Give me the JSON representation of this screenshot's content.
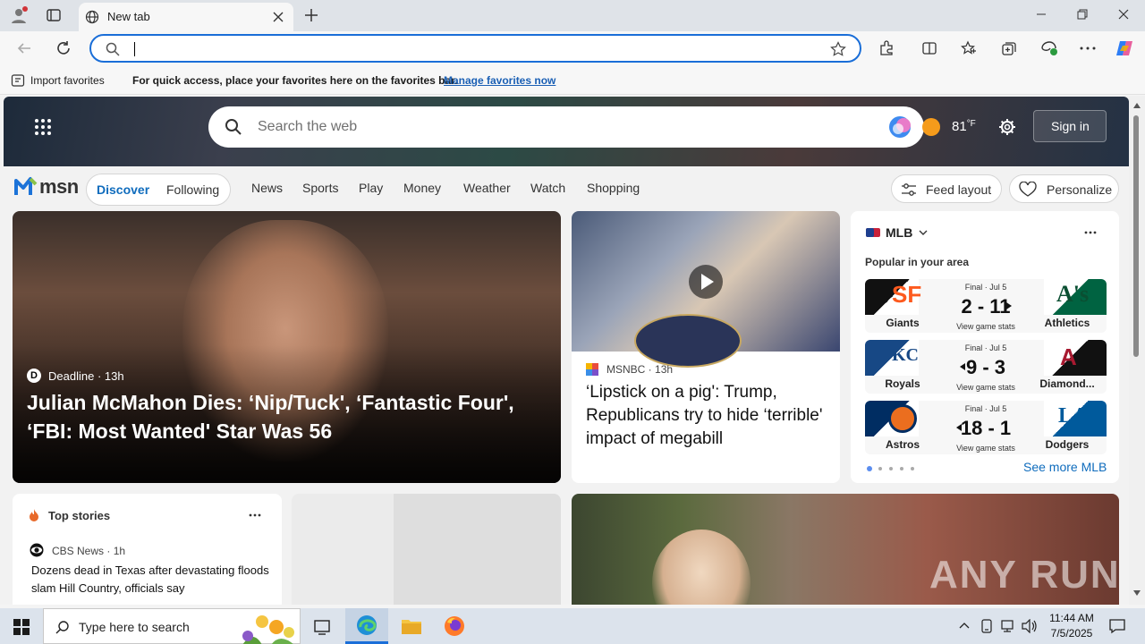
{
  "browser": {
    "tab_title": "New tab",
    "address_value": "",
    "favbar": {
      "import_label": "Import favorites",
      "message": "For quick access, place your favorites here on the favorites bar.",
      "manage_link": "Manage favorites now"
    }
  },
  "msn": {
    "search_placeholder": "Search the web",
    "weather_temp": "81",
    "weather_unit": "°F",
    "sign_in": "Sign in",
    "logo_text": "msn",
    "tabs": [
      "Discover",
      "Following"
    ],
    "nav": [
      "News",
      "Sports",
      "Play",
      "Money",
      "Weather",
      "Watch",
      "Shopping"
    ],
    "feed_layout": "Feed layout",
    "personalize": "Personalize",
    "hero_article": {
      "source": "Deadline",
      "age": "13h",
      "headline": "Julian McMahon Dies: ‘Nip/Tuck', ‘Fantastic Four', ‘FBI: Most Wanted' Star Was 56"
    },
    "video_article": {
      "source": "MSNBC",
      "age": "13h",
      "headline": "‘Lipstick on a pig': Trump, Republicans try to hide ‘terrible' impact of megabill"
    },
    "mlb": {
      "title": "MLB",
      "subtitle": "Popular in your area",
      "games": [
        {
          "home": "Giants",
          "away": "Athletics",
          "status": "Final · Jul 5",
          "score": "2 - 11",
          "stats": "View game stats",
          "arrow": "right"
        },
        {
          "home": "Royals",
          "away": "Diamond...",
          "status": "Final · Jul 5",
          "score": "9 - 3",
          "stats": "View game stats",
          "arrow": "left"
        },
        {
          "home": "Astros",
          "away": "Dodgers",
          "status": "Final · Jul 5",
          "score": "18 - 1",
          "stats": "View game stats",
          "arrow": "left"
        }
      ],
      "see_more": "See more MLB"
    },
    "top_stories": {
      "title": "Top stories",
      "source": "CBS News",
      "age": "1h",
      "headline": "Dozens dead in Texas after devastating floods slam Hill Country, officials say"
    },
    "watermark": "ANY RUN"
  },
  "taskbar": {
    "search_placeholder": "Type here to search",
    "time": "11:44 AM",
    "date": "7/5/2025"
  },
  "colors": {
    "accent": "#1a6ed8",
    "msn_blue": "#0f6cbd",
    "taskbar": "#dce3ec"
  }
}
